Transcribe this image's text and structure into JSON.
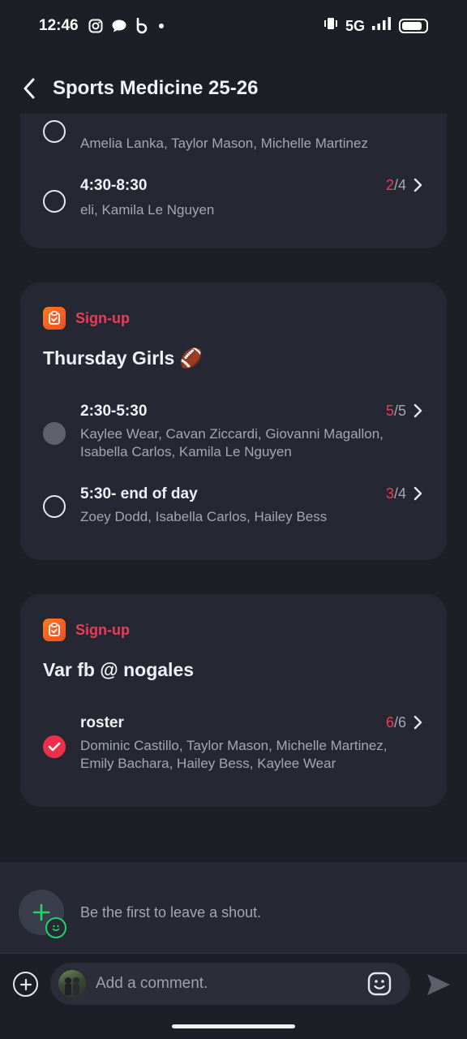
{
  "status_bar": {
    "time": "12:46",
    "network": "5G",
    "icons": [
      "instagram-icon",
      "chat-bubble-icon",
      "b-app-icon",
      "dot-icon",
      "vibrate-icon",
      "signal-icon",
      "battery-icon"
    ],
    "battery_level": 0.85
  },
  "header": {
    "title": "Sports Medicine 25-26"
  },
  "cards": [
    {
      "slots": [
        {
          "time": "",
          "names": "Amelia Lanka, Taylor Mason, Michelle Martinez",
          "state": "empty"
        },
        {
          "time": "4:30-8:30",
          "names": "eli, Kamila Le Nguyen",
          "taken": "2",
          "total": "/4",
          "state": "empty"
        }
      ]
    },
    {
      "tag": "Sign-up",
      "title": "Thursday Girls 🏈",
      "slots": [
        {
          "time": "2:30-5:30",
          "names": "Kaylee Wear, Cavan Ziccardi, Giovanni Magallon, Isabella Carlos, Kamila Le Nguyen",
          "taken": "5",
          "total": "/5",
          "state": "full"
        },
        {
          "time": "5:30- end of day",
          "names": "Zoey Dodd, Isabella Carlos, Hailey Bess",
          "taken": "3",
          "total": "/4",
          "state": "empty"
        }
      ]
    },
    {
      "tag": "Sign-up",
      "title": "Var fb @ nogales",
      "slots": [
        {
          "time": "roster",
          "names": "Dominic Castillo, Taylor Mason, Michelle Martinez, Emily Bachara, Hailey Bess, Kaylee Wear",
          "taken": "6",
          "total": "/6",
          "state": "checked"
        }
      ]
    }
  ],
  "shout": {
    "text": "Be the first to leave a shout."
  },
  "comment": {
    "placeholder": "Add a comment."
  },
  "colors": {
    "background": "#1d1f27",
    "card": "#252833",
    "accent_red": "#ef3b55",
    "signup_orange": "#f4602a",
    "shout_green": "#1fd46b"
  }
}
